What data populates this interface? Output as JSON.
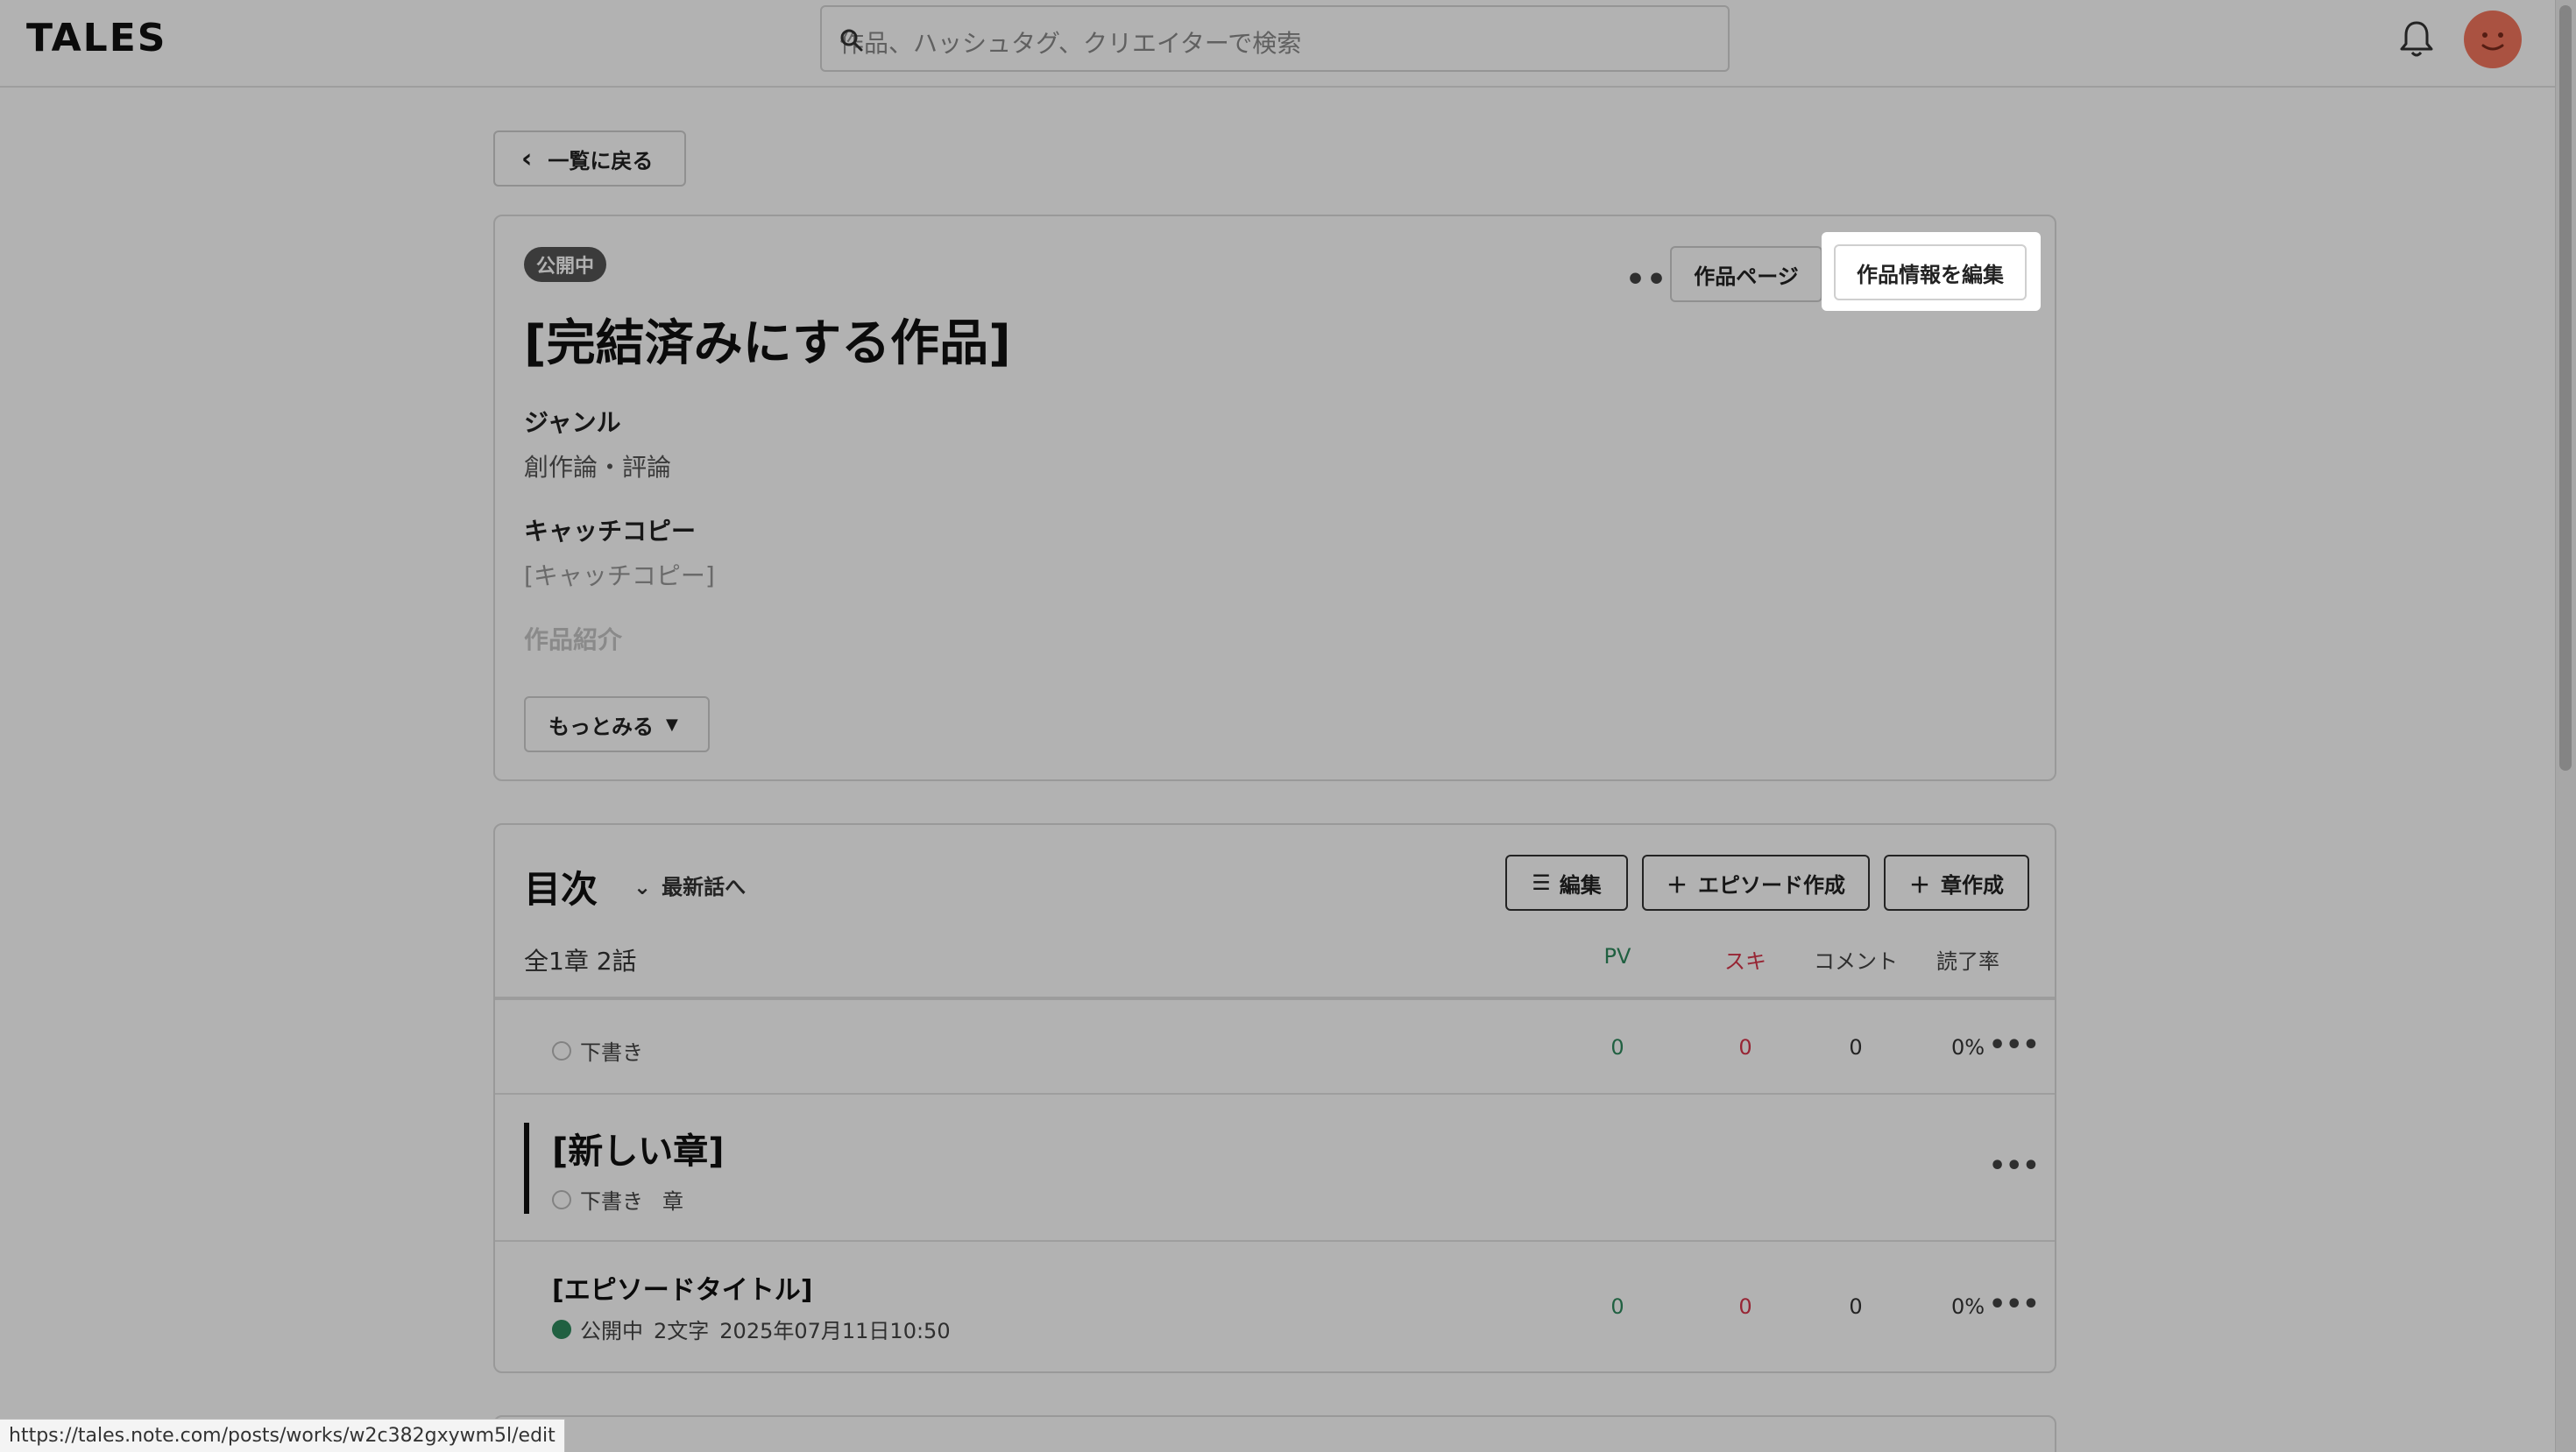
{
  "header": {
    "logo": "TALES",
    "search_placeholder": "作品、ハッシュタグ、クリエイターで検索"
  },
  "back_button": "一覧に戻る",
  "work": {
    "status": "公開中",
    "title": "[完結済みにする作品]",
    "more_icon": "ellipsis-icon",
    "work_page_button": "作品ページ",
    "edit_button": "作品情報を編集",
    "genre_label": "ジャンル",
    "genre_value": "創作論・評論",
    "catchcopy_label": "キャッチコピー",
    "catchcopy_value": "[キャッチコピー]",
    "intro_label": "作品紹介",
    "more_button": "もっとみる"
  },
  "toc": {
    "title": "目次",
    "latest_link": "最新話へ",
    "edit_button": "編集",
    "create_episode_button": "エピソード作成",
    "create_chapter_button": "章作成",
    "count": "全1章 2話",
    "columns": {
      "pv": "PV",
      "suki": "スキ",
      "comment": "コメント",
      "read_rate": "読了率"
    },
    "rows": [
      {
        "type": "episode",
        "status": "下書き",
        "pv": "0",
        "suki": "0",
        "comment": "0",
        "read_rate": "0%"
      },
      {
        "type": "chapter",
        "title": "[新しい章]",
        "status": "下書き",
        "kind": "章"
      },
      {
        "type": "episode",
        "title": "[エピソードタイトル]",
        "status": "公開中",
        "chars": "2文字",
        "date": "2025年07月11日10:50",
        "pv": "0",
        "suki": "0",
        "comment": "0",
        "read_rate": "0%"
      }
    ]
  },
  "status_url": "https://tales.note.com/posts/works/w2c382gxywm5l/edit",
  "colors": {
    "pv": "#2f8a5e",
    "suki": "#d9364b",
    "avatar": "#f4765e"
  }
}
